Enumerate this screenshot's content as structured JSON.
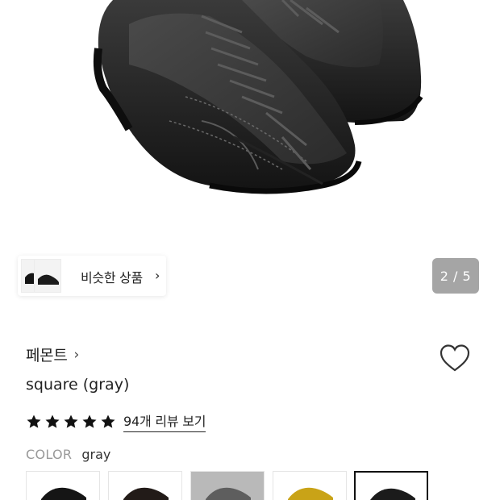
{
  "gallery": {
    "image_alt": "square (gray) product photo",
    "counter": "2 / 5"
  },
  "similar": {
    "label": "비슷한 상품",
    "chevron": "›",
    "icon": "chevron-right-icon"
  },
  "product": {
    "brand": "페몬트",
    "brand_chevron": "›",
    "name": "square (gray)",
    "rating": 5,
    "review_link": "94개 리뷰 보기",
    "wishlist_icon": "heart-outline-icon"
  },
  "color": {
    "label": "COLOR",
    "value": "gray",
    "options": [
      {
        "name": "black",
        "swatch": "#1a1a1a"
      },
      {
        "name": "black-brown",
        "swatch": "#2a2220"
      },
      {
        "name": "gray",
        "swatch": "#6b6b6b"
      },
      {
        "name": "yellow",
        "swatch": "#c9a317"
      },
      {
        "name": "selected-gray",
        "swatch": "#1f1f1f",
        "selected": true
      }
    ]
  },
  "colors": {
    "counter_bg": "#a5a5a5",
    "text": "#222222",
    "muted": "#999999"
  }
}
